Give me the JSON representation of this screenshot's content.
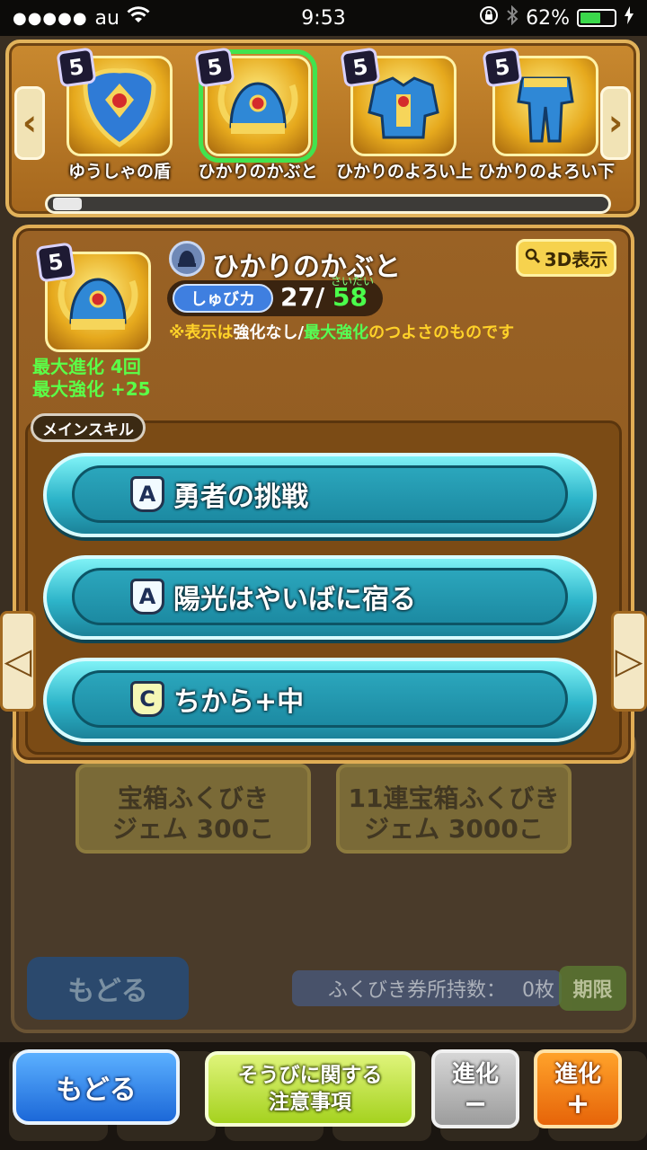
{
  "status_bar": {
    "signal": "●●●●●",
    "carrier": "au",
    "wifi_icon": "wifi-icon",
    "time": "9:53",
    "battery": "62%",
    "battery_level": 0.62
  },
  "carousel": {
    "items": [
      {
        "rank": "5",
        "name": "ゆうしゃの盾",
        "icon": "shield-icon"
      },
      {
        "rank": "5",
        "name": "ひかりのかぶと",
        "icon": "helmet-icon",
        "selected": true
      },
      {
        "rank": "5",
        "name": "ひかりのよろい上",
        "icon": "armor-upper-icon"
      },
      {
        "rank": "5",
        "name": "ひかりのよろい下",
        "icon": "armor-lower-icon"
      }
    ],
    "prev_arrow": "‹",
    "next_arrow": "›"
  },
  "detail": {
    "rank": "5",
    "name": "ひかりのかぶと",
    "type_icon": "helmet-type-icon",
    "view_3d_label": "3D表示",
    "stat_label": "しゅびカ",
    "stat_value": "27",
    "stat_separator": "/",
    "stat_max": "58",
    "stat_max_ruby": "さいだい",
    "note_prefix": "※表示は",
    "note_no_enh": "強化なし",
    "note_slash": "/",
    "note_max_enh": "最大強化",
    "note_suffix": "のつよさのものです",
    "max_evolution": "最大進化 4回",
    "max_enhancement": "最大強化 +25"
  },
  "skills": {
    "tag": "メインスキル",
    "items": [
      {
        "grade": "A",
        "label": "勇者の挑戦"
      },
      {
        "grade": "A",
        "label": "陽光はやいばに宿る"
      },
      {
        "grade": "C",
        "label": "ちから+中"
      }
    ]
  },
  "dialog_arrows": {
    "left": "◁",
    "right": "▷"
  },
  "background": {
    "lottery_1_title": "宝箱ふくびき",
    "lottery_1_cost": "ジェム 300こ",
    "lottery_2_title": "11連宝箱ふくびき",
    "lottery_2_cost": "ジェム 3000こ",
    "back_label": "もどる",
    "ticket_label": "ふくびき券所持数：",
    "ticket_count": "0枚",
    "limit_label": "期限"
  },
  "actions": {
    "back": "もどる",
    "notice_line1": "そうびに関する",
    "notice_line2": "注意事項",
    "evo_minus_label": "進化",
    "evo_minus_sym": "−",
    "evo_plus_label": "進化",
    "evo_plus_sym": "+"
  },
  "colors": {
    "frame_gold": "#e0ad55",
    "skill_cyan": "#2db4c9",
    "stat_blue": "#3f7fe0",
    "max_green": "#4bff4b",
    "note_yellow": "#ffd229"
  }
}
